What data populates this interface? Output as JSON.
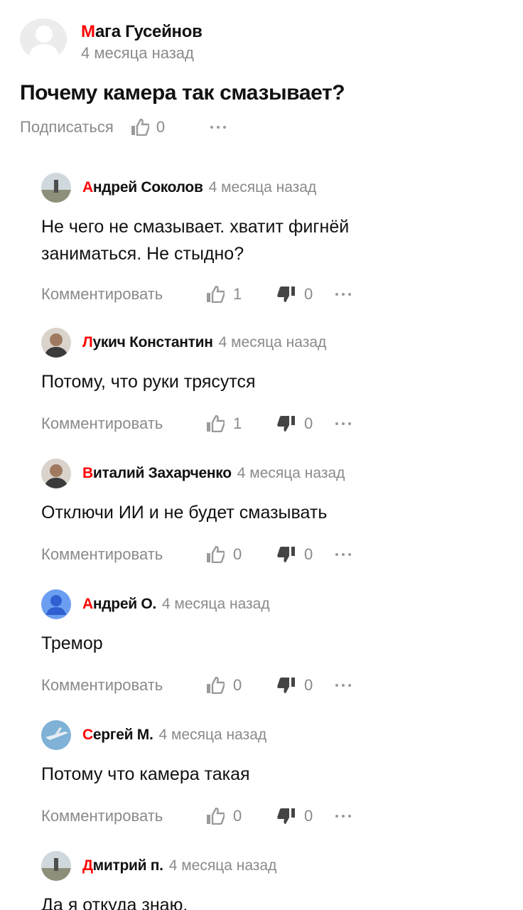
{
  "question": {
    "author_first_letter": "М",
    "author_rest": "ага Гусейнов",
    "date": "4 месяца назад",
    "title": "Почему камера так смазывает?",
    "subscribe_label": "Подписаться",
    "likes": "0"
  },
  "action_labels": {
    "comment": "Комментировать"
  },
  "comments": [
    {
      "first_letter": "А",
      "name_rest": "ндрей Соколов",
      "date": "4 месяца назад",
      "text": "Не чего не смазывает. хватит фигнёй заниматься. Не стыдно?",
      "likes": "1",
      "dislikes": "0",
      "avatar": "landscape-avatar"
    },
    {
      "first_letter": "Л",
      "name_rest": "укич Константин",
      "date": "4 месяца назад",
      "text": "Потому, что руки трясутся",
      "likes": "1",
      "dislikes": "0",
      "avatar": "photo-avatar"
    },
    {
      "first_letter": "В",
      "name_rest": "италий Захарченко",
      "date": "4 месяца назад",
      "text": "Отключи ИИ и не будет смазывать",
      "likes": "0",
      "dislikes": "0",
      "avatar": "photo-avatar"
    },
    {
      "first_letter": "А",
      "name_rest": "ндрей О.",
      "date": "4 месяца назад",
      "text": "Тремор",
      "likes": "0",
      "dislikes": "0",
      "avatar": "default-user-avatar"
    },
    {
      "first_letter": "С",
      "name_rest": "ергей М.",
      "date": "4 месяца назад",
      "text": "Потому что камера такая",
      "likes": "0",
      "dislikes": "0",
      "avatar": "airplane-avatar"
    },
    {
      "first_letter": "Д",
      "name_rest": "митрий п.",
      "date": "4 месяца назад",
      "text": "Да я откуда  знаю.",
      "avatar": "landscape-avatar"
    }
  ],
  "colors": {
    "accent": "#ff0000",
    "muted": "#8a8a8a",
    "text": "#111111",
    "blue_avatar": "#6b9ef0"
  }
}
